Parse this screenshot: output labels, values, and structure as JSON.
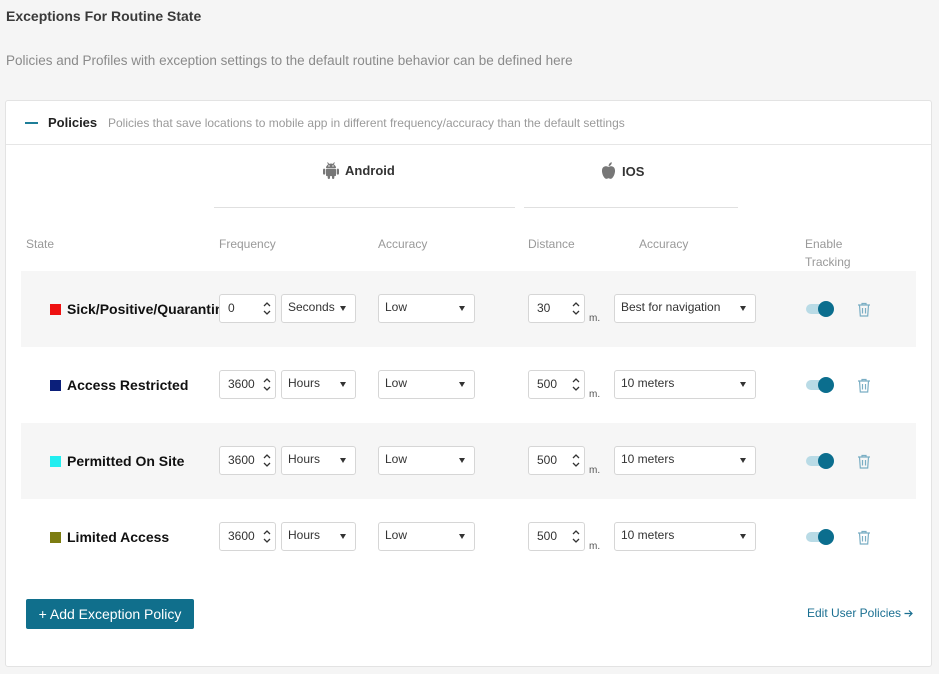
{
  "page": {
    "title": "Exceptions For Routine State",
    "subtitle": "Policies and Profiles with exception settings to the default routine behavior can be defined here"
  },
  "section": {
    "title": "Policies",
    "description": "Policies that save locations to mobile app in different frequency/accuracy than the default settings"
  },
  "platforms": {
    "android": "Android",
    "ios": "IOS"
  },
  "columns": {
    "state": "State",
    "frequency": "Frequency",
    "accuracy_android": "Accuracy",
    "distance": "Distance",
    "accuracy_ios": "Accuracy",
    "enable_tracking": "Enable Tracking"
  },
  "distance_unit": "m.",
  "rows": [
    {
      "name": "Sick/Positive/Quarantine",
      "color": "#ee1111",
      "frequency": "0",
      "frequency_unit": "Seconds",
      "android_accuracy": "Low",
      "distance": "30",
      "ios_accuracy": "Best for navigation",
      "tracking_enabled": true
    },
    {
      "name": "Access Restricted",
      "color": "#0b1f7a",
      "frequency": "3600",
      "frequency_unit": "Hours",
      "android_accuracy": "Low",
      "distance": "500",
      "ios_accuracy": "10 meters",
      "tracking_enabled": true
    },
    {
      "name": "Permitted On Site",
      "color": "#22eef0",
      "frequency": "3600",
      "frequency_unit": "Hours",
      "android_accuracy": "Low",
      "distance": "500",
      "ios_accuracy": "10 meters",
      "tracking_enabled": true
    },
    {
      "name": "Limited Access",
      "color": "#7c7c11",
      "frequency": "3600",
      "frequency_unit": "Hours",
      "android_accuracy": "Low",
      "distance": "500",
      "ios_accuracy": "10 meters",
      "tracking_enabled": true
    }
  ],
  "actions": {
    "add_label": "+ Add Exception Policy",
    "edit_label": "Edit User Policies"
  },
  "icons": {
    "collapse": "minus-icon",
    "android": "android-icon",
    "ios": "apple-icon",
    "spinner": "up-down-spinner-icon",
    "caret": "caret-down-icon",
    "delete": "trash-icon",
    "edit": "arrow-right-icon"
  },
  "colors": {
    "accent": "#106f8c",
    "toggle_on": "#0b6e8e",
    "link": "#1a6f91"
  }
}
